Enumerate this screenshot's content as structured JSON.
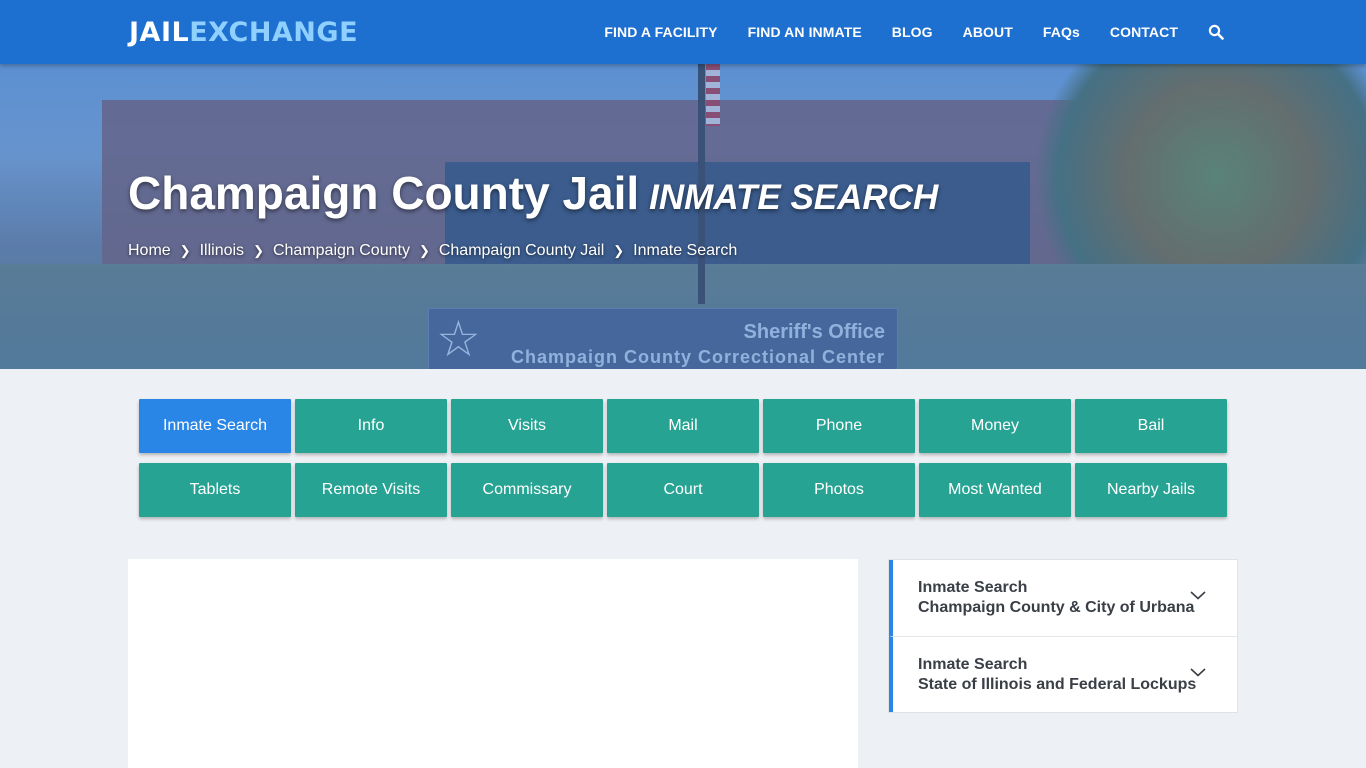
{
  "brand": {
    "part1": "JAIL",
    "part2": "EXCHANGE"
  },
  "nav": {
    "items": [
      "FIND A FACILITY",
      "FIND AN INMATE",
      "BLOG",
      "ABOUT",
      "FAQs",
      "CONTACT"
    ],
    "search_icon": "search-icon"
  },
  "hero": {
    "title": "Champaign County Jail",
    "subtitle": "INMATE SEARCH",
    "sign_line1": "Sheriff's Office",
    "sign_line2": "Champaign County Correctional Center",
    "breadcrumbs": [
      "Home",
      "Illinois",
      "Champaign County",
      "Champaign County Jail",
      "Inmate Search"
    ]
  },
  "buttons": {
    "row1": [
      "Inmate Search",
      "Info",
      "Visits",
      "Mail",
      "Phone",
      "Money",
      "Bail"
    ],
    "row2": [
      "Tablets",
      "Remote Visits",
      "Commissary",
      "Court",
      "Photos",
      "Most Wanted",
      "Nearby Jails"
    ],
    "active": "Inmate Search"
  },
  "sidebar": {
    "items": [
      {
        "title": "Inmate Search",
        "subtitle": "Champaign County & City of Urbana"
      },
      {
        "title": "Inmate Search",
        "subtitle": "State of Illinois and Federal Lockups"
      }
    ]
  },
  "colors": {
    "nav": "#1d6fd0",
    "button": "#27a393",
    "active": "#2a86e6"
  }
}
